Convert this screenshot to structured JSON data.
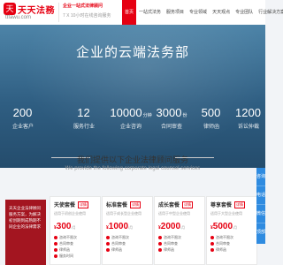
{
  "brand": {
    "logo_mark": "天",
    "name": "天天法務",
    "url": "ttfawu.com",
    "slogan_line1": "企业一站式法律顾问",
    "slogan_line2": "7 X 10小时在线咨询服务"
  },
  "nav": {
    "items": [
      {
        "label": "首页",
        "active": true
      },
      {
        "label": "一站式法务",
        "active": false
      },
      {
        "label": "服务项目",
        "active": false
      },
      {
        "label": "专业领域",
        "active": false
      },
      {
        "label": "天天观点",
        "active": false
      },
      {
        "label": "专业团队",
        "active": false
      },
      {
        "label": "行业解决方案",
        "active": false
      }
    ]
  },
  "hero": {
    "title": "企业的云端法务部"
  },
  "stats": [
    {
      "value": "200",
      "unit": "",
      "label": "企业客户"
    },
    {
      "value": "12",
      "unit": "",
      "label": "服务行业"
    },
    {
      "value": "10000",
      "unit": "分钟",
      "label": "企业咨询"
    },
    {
      "value": "3000",
      "unit": "份",
      "label": "合同审查"
    },
    {
      "value": "500",
      "unit": "",
      "label": "律师函"
    },
    {
      "value": "1200",
      "unit": "",
      "label": "诉讼仲裁"
    }
  ],
  "section": {
    "title": "我们提供以下企业法律顾问服务",
    "subtitle": "We provide the following corporate legal counsel services"
  },
  "intro": {
    "text": "天天企业法律顾问服务方案，为解决初创期到成熟期不同企业的法律需求"
  },
  "cards": [
    {
      "title": "天使套餐",
      "badge": "详情",
      "desc": "适用于初创企业使用",
      "price": "300",
      "currency": "¥",
      "unit": "/月",
      "items": [
        "咨询不限次",
        "合同审查",
        "律师函",
        "服务时间"
      ]
    },
    {
      "title": "标准套餐",
      "badge": "详情",
      "desc": "适用于成长型企业使用",
      "price": "1000",
      "currency": "¥",
      "unit": "/月",
      "items": [
        "咨询不限次",
        "合同审查",
        "律师函"
      ]
    },
    {
      "title": "成长套餐",
      "badge": "详情",
      "desc": "适用于中型企业使用",
      "price": "2000",
      "currency": "¥",
      "unit": "/月",
      "items": [
        "咨询不限次",
        "合同审查",
        "律师函"
      ]
    },
    {
      "title": "尊享套餐",
      "badge": "详情",
      "desc": "适用于大型企业使用",
      "price": "5000",
      "currency": "¥",
      "unit": "/月",
      "items": [
        "咨询不限次",
        "合同审查",
        "律师函"
      ]
    }
  ],
  "side": {
    "buttons": [
      "咨询",
      "电话",
      "微信",
      "顶部"
    ]
  },
  "colors": {
    "brand_red": "#e60012",
    "hero_blue": "#2f5e82",
    "side_blue": "#2f8be0"
  }
}
